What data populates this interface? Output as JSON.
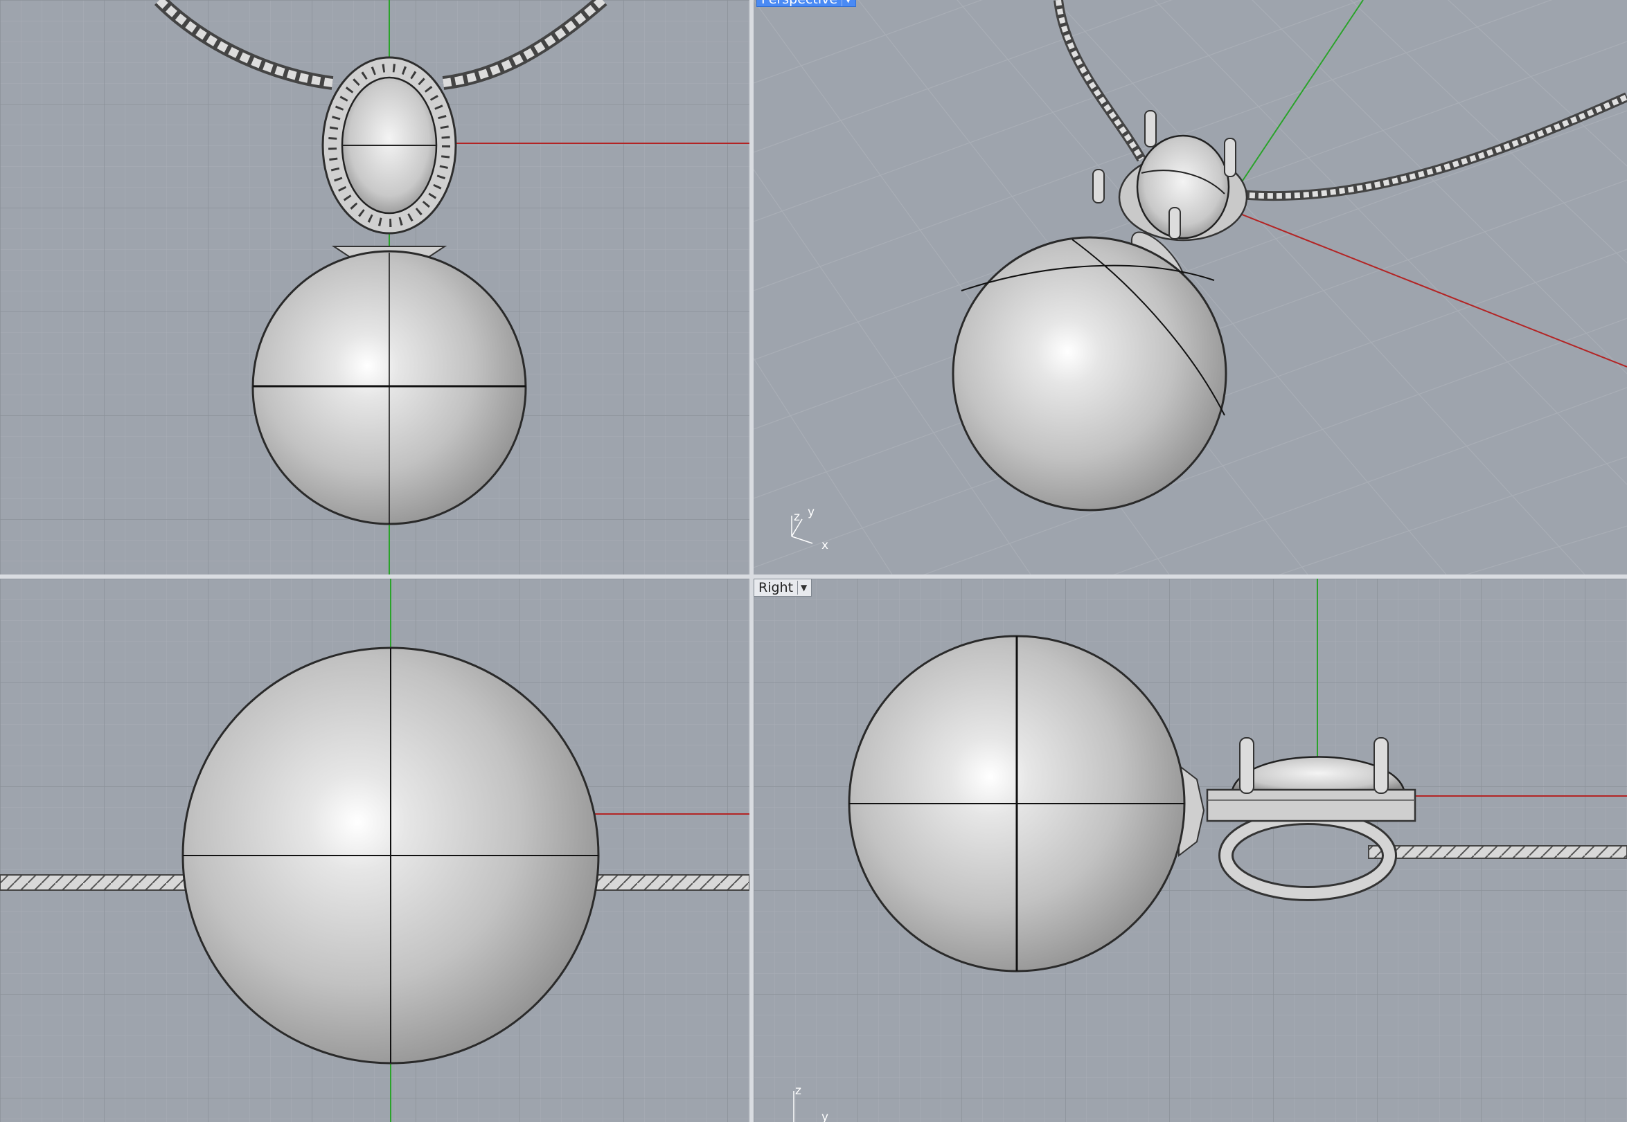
{
  "viewports": {
    "top_left": {
      "name": ""
    },
    "perspective": {
      "label": "Perspective",
      "axis_labels": {
        "x": "x",
        "y": "y",
        "z": "z"
      }
    },
    "bottom_left": {
      "name": ""
    },
    "right": {
      "label": "Right",
      "axis_labels": {
        "z": "z",
        "y": "y"
      }
    }
  },
  "colors": {
    "viewport_bg": "#9ea4ad",
    "grid_minor": "#a6acb4",
    "grid_major": "#8c929b",
    "x_axis": "#b32424",
    "y_axis": "#2aa32a",
    "active_tab": "#4a8af4"
  },
  "icons": {
    "tab_dropdown": "chevron-down-icon"
  }
}
